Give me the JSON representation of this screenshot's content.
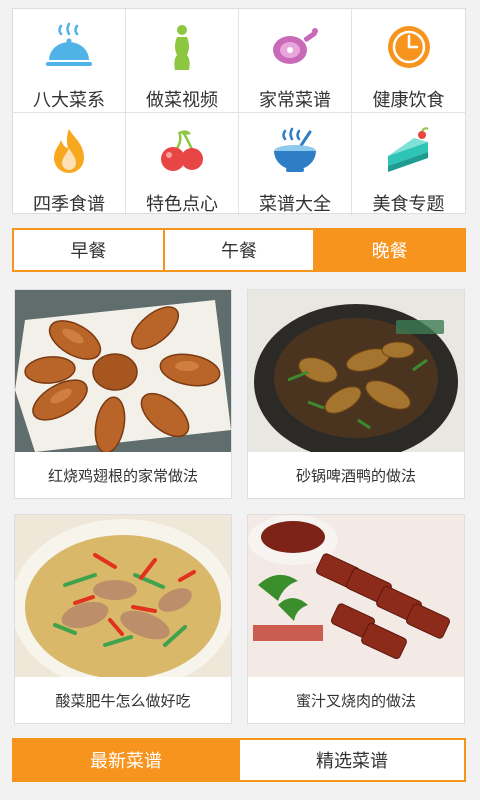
{
  "categories": [
    {
      "label": "八大菜系",
      "icon": "food-cloche-icon",
      "color": "#4fb3e8"
    },
    {
      "label": "做菜视频",
      "icon": "figure-icon",
      "color": "#8dc63f"
    },
    {
      "label": "家常菜谱",
      "icon": "ham-icon",
      "color": "#c86ab8"
    },
    {
      "label": "健康饮食",
      "icon": "clock-icon",
      "color": "#f7941d"
    },
    {
      "label": "四季食谱",
      "icon": "flame-icon",
      "color": "#f7a81d"
    },
    {
      "label": "特色点心",
      "icon": "cherry-icon",
      "color": "#e84545"
    },
    {
      "label": "菜谱大全",
      "icon": "soup-bowl-icon",
      "color": "#2e7ec6"
    },
    {
      "label": "美食专题",
      "icon": "cake-slice-icon",
      "color": "#2ec4b6"
    }
  ],
  "meal_tabs": [
    {
      "label": "早餐",
      "active": false
    },
    {
      "label": "午餐",
      "active": false
    },
    {
      "label": "晚餐",
      "active": true
    }
  ],
  "recipes": [
    {
      "title": "红烧鸡翅根的家常做法",
      "image": "chicken-drumettes-photo"
    },
    {
      "title": "砂锅啤酒鸭的做法",
      "image": "beer-duck-clay-pot-photo"
    },
    {
      "title": "酸菜肥牛怎么做好吃",
      "image": "pickled-cabbage-beef-photo"
    },
    {
      "title": "蜜汁叉烧肉的做法",
      "image": "honey-char-siu-photo"
    }
  ],
  "bottom_tabs": [
    {
      "label": "最新菜谱",
      "active": true
    },
    {
      "label": "精选菜谱",
      "active": false
    }
  ],
  "colors": {
    "accent": "#f7941d",
    "border": "#dddddd",
    "background": "#f2f2f2"
  }
}
